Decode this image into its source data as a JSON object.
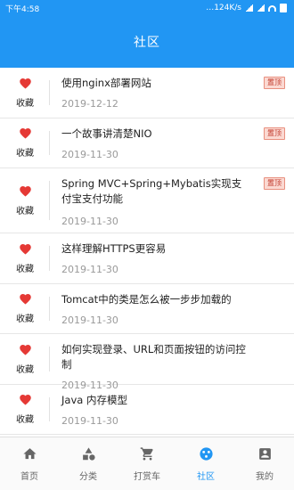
{
  "statusbar": {
    "time": "下午4:58",
    "net": "…124K/s"
  },
  "appbar": {
    "title": "社区"
  },
  "colors": {
    "primary": "#2196f3",
    "heart": "#e53935",
    "pin_bg": "#fbd9d2"
  },
  "fav_label": "收藏",
  "items": [
    {
      "title": "使用nginx部署网站",
      "date": "2019-12-12",
      "pinned": true,
      "pin_label": "置顶"
    },
    {
      "title": "一个故事讲清楚NIO",
      "date": "2019-11-30",
      "pinned": true,
      "pin_label": "置顶"
    },
    {
      "title": "Spring MVC+Spring+Mybatis实现支付宝支付功能",
      "date": "2019-11-30",
      "pinned": true,
      "pin_label": "置顶"
    },
    {
      "title": "这样理解HTTPS更容易",
      "date": "2019-11-30",
      "pinned": false
    },
    {
      "title": "Tomcat中的类是怎么被一步步加载的",
      "date": "2019-11-30",
      "pinned": false
    },
    {
      "title": "如何实现登录、URL和页面按钮的访问控制",
      "date": "2019-11-30",
      "pinned": false
    },
    {
      "title": "Java 内存模型",
      "date": "2019-11-30",
      "pinned": false
    }
  ],
  "tabs": [
    {
      "label": "首页",
      "icon": "home-icon"
    },
    {
      "label": "分类",
      "icon": "category-icon"
    },
    {
      "label": "打赏车",
      "icon": "cart-icon"
    },
    {
      "label": "社区",
      "icon": "community-icon",
      "active": true
    },
    {
      "label": "我的",
      "icon": "profile-icon"
    }
  ]
}
